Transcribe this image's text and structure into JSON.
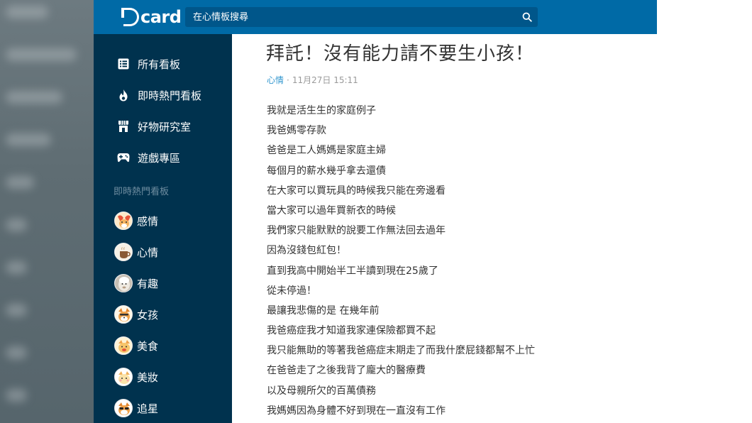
{
  "header": {
    "logo_text": "card",
    "search_placeholder": "在心情板搜尋",
    "icons": {
      "search": "search-icon"
    }
  },
  "sidebar": {
    "nav": [
      {
        "label": "所有看板",
        "icon": "list-icon"
      },
      {
        "label": "即時熱門看板",
        "icon": "fire-icon"
      },
      {
        "label": "好物研究室",
        "icon": "store-icon"
      },
      {
        "label": "遊戲專區",
        "icon": "gamepad-icon"
      }
    ],
    "section_title": "即時熱門看板",
    "boards": [
      {
        "label": "感情",
        "avatar": "dog-avatar"
      },
      {
        "label": "心情",
        "avatar": "coffee-avatar"
      },
      {
        "label": "有趣",
        "avatar": "alpaca-avatar"
      },
      {
        "label": "女孩",
        "avatar": "shiba-avatar"
      },
      {
        "label": "美食",
        "avatar": "food-avatar"
      },
      {
        "label": "美妝",
        "avatar": "makeup-avatar"
      },
      {
        "label": "追星",
        "avatar": "star-avatar"
      }
    ]
  },
  "post": {
    "title": "拜託！沒有能力請不要生小孩！",
    "board": "心情",
    "separator": "·",
    "datetime": "11月27日 15:11",
    "lines": [
      "我就是活生生的家庭例子",
      "我爸媽零存款",
      "爸爸是工人媽媽是家庭主婦",
      "每個月的薪水幾乎拿去還債",
      "在大家可以買玩具的時候我只能在旁邊看",
      "當大家可以過年買新衣的時候",
      "我們家只能默默的說要工作無法回去過年",
      "因為沒錢包紅包！",
      "直到我高中開始半工半讀到現在25歲了",
      "從未停過！",
      "最讓我悲傷的是 在幾年前",
      "我爸癌症我才知道我家連保險都買不起",
      "我只能無助的等著我爸癌症末期走了而我什麼屁錢都幫不上忙",
      "在爸爸走了之後我背了龐大的醫療費",
      "以及母親所欠的百萬債務",
      "我媽媽因為身體不好到現在一直沒有工作"
    ]
  },
  "colors": {
    "header": "#006aa6",
    "sidebar": "#00324e",
    "board_link": "#3397cf",
    "text": "#333333"
  }
}
